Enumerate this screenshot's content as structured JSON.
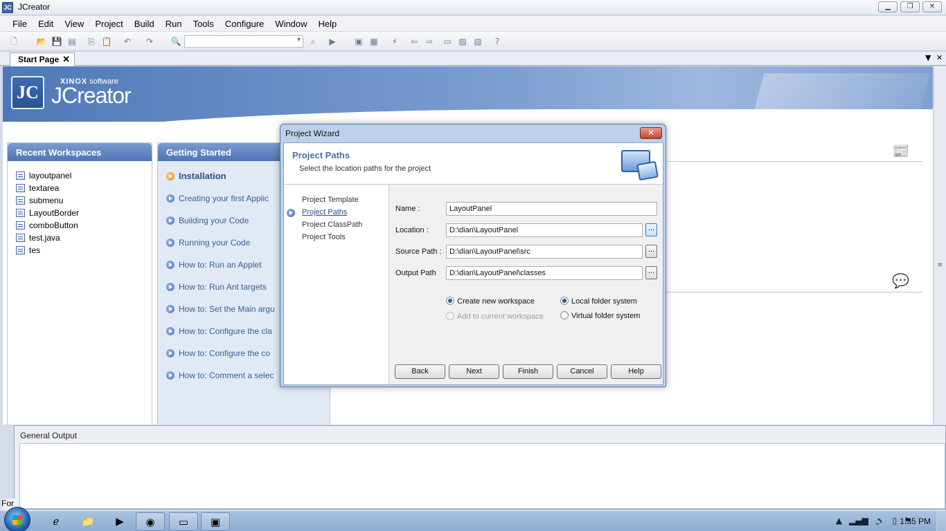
{
  "window": {
    "title": "JCreator",
    "icon": "jcreator-app-icon"
  },
  "menu": [
    "File",
    "Edit",
    "View",
    "Project",
    "Build",
    "Run",
    "Tools",
    "Configure",
    "Window",
    "Help"
  ],
  "tabs": {
    "start_page": "Start Page",
    "close": "✕"
  },
  "hero": {
    "logo_glyph": "JC",
    "brand_bold": "XINOX",
    "brand_rest": " software",
    "product": "JCreator"
  },
  "recent_workspaces": {
    "title": "Recent Workspaces",
    "items": [
      "layoutpanel",
      "textarea",
      "submenu",
      "LayoutBorder",
      "comboButton",
      "test.java",
      "tes"
    ]
  },
  "getting_started": {
    "title": "Getting Started",
    "items": [
      "Installation",
      "Creating your first Applic",
      "Building your Code",
      "Running your Code",
      "How to: Run an Applet",
      "How to: Run Ant targets",
      "How to: Set the Main argu",
      "How to: Configure the cla",
      "How to: Configure the co",
      "How to: Comment a selec"
    ]
  },
  "output": {
    "title": "General Output"
  },
  "status": {
    "left_text": "For"
  },
  "dialog": {
    "title": "Project Wizard",
    "close": "✕",
    "header_title": "Project Paths",
    "header_subtitle": "Select the location paths for the project",
    "steps": [
      "Project Template",
      "Project Paths",
      "Project ClassPath",
      "Project Tools"
    ],
    "active_step": "Project Paths",
    "fields": {
      "name_label": "Name :",
      "name_value": "LayoutPanel",
      "location_label": "Location :",
      "location_value": "D:\\dian\\LayoutPanel",
      "source_label": "Source Path :",
      "source_value": "D:\\dian\\LayoutPanel\\src",
      "output_label": "Output Path",
      "output_value": "D:\\dian\\LayoutPanel\\classes",
      "browse": "..."
    },
    "options": {
      "create_new_workspace": "Create new workspace",
      "add_to_current_workspace": "Add to current workspace",
      "local_folder_system": "Local folder system",
      "virtual_folder_system": "Virtual folder system"
    },
    "buttons": {
      "back": "Back",
      "next": "Next",
      "finish": "Finish",
      "cancel": "Cancel",
      "help": "Help"
    }
  },
  "taskbar": {
    "clock": "1:35 PM"
  }
}
